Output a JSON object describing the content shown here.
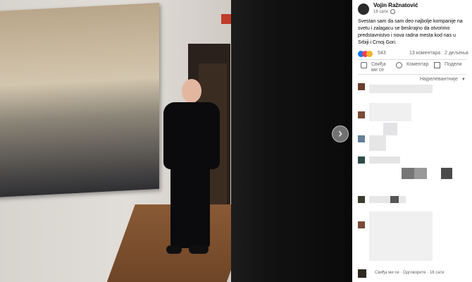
{
  "post": {
    "author": "Vojin Ražnatović",
    "time": "16 сати",
    "text": "Svestan sam da sam deo najbolje kompanije na svetu i zalagacu se beskrajno da otvorimo predstavnistvo i nova radna mesta kod nas u Srbiji i Crnoj Gori.",
    "reactions_count": "543",
    "comments_count": "13 коментара",
    "shares_count": "2 дељења"
  },
  "actions": {
    "like": "Свиђа ми се",
    "comment": "Коментар",
    "share": "Подели"
  },
  "sort": {
    "label": "Најрелевантније"
  },
  "footer": {
    "text": "Свиђа ми се · Одговорите · 16 сати"
  },
  "colors": {
    "like_blue": "#1877f2",
    "love_red": "#f33e58",
    "haha_yellow": "#f7b125",
    "text_gray": "#65676b"
  }
}
